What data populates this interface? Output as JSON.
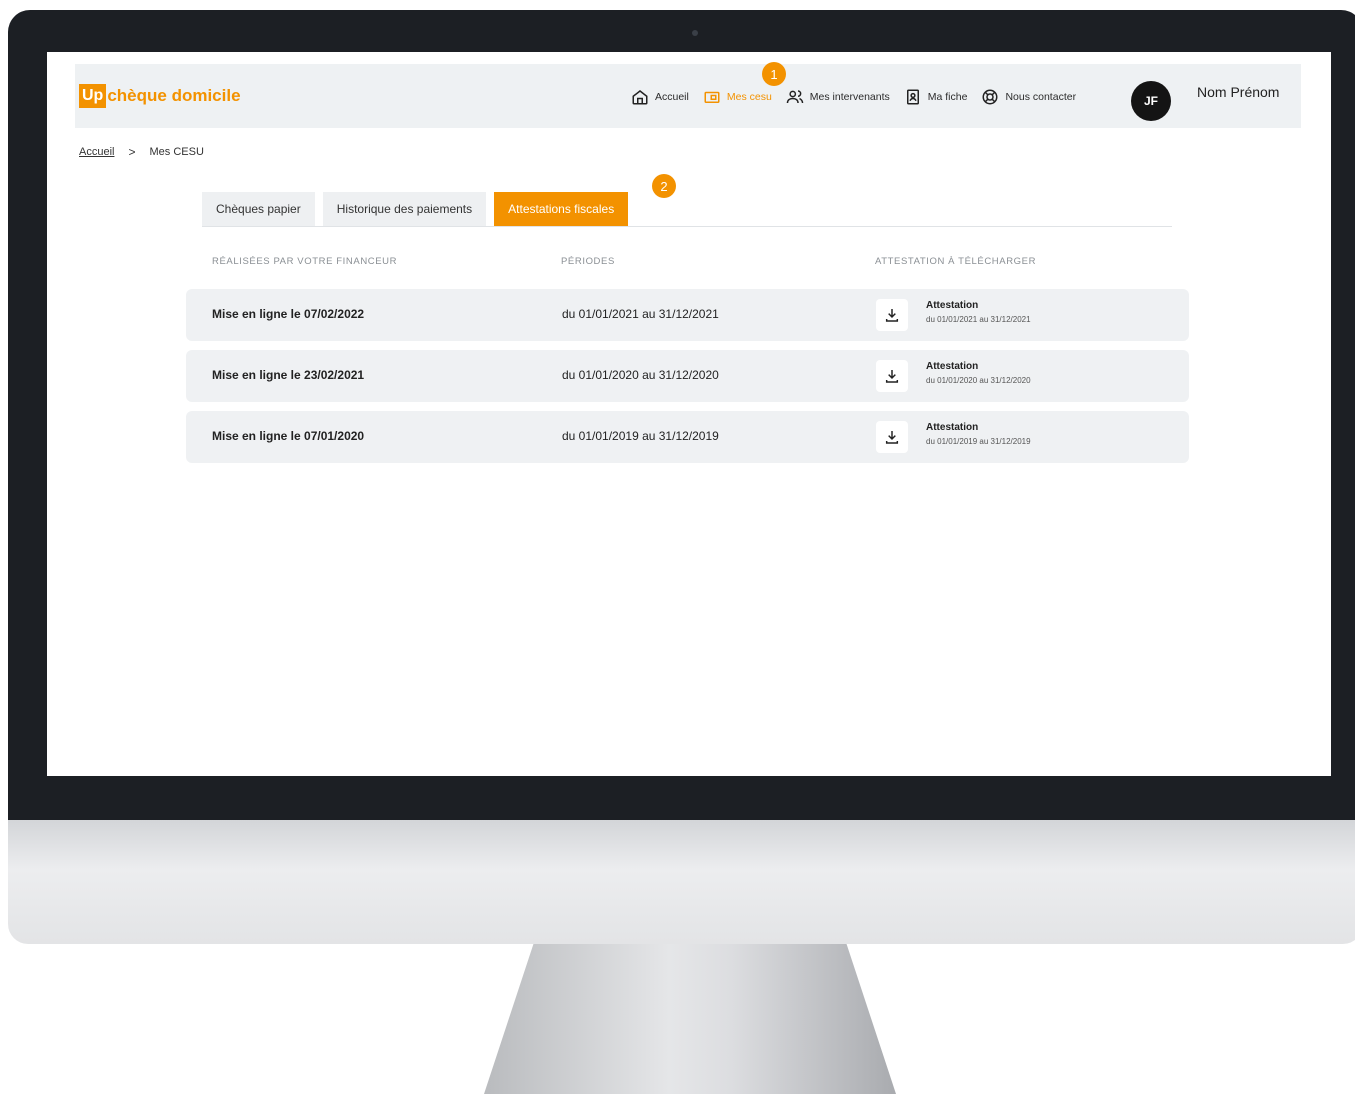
{
  "header": {
    "logo_up": "Up",
    "logo_text": "chèque domicile",
    "nav": [
      {
        "label": "Accueil",
        "icon": "home-icon",
        "active": false
      },
      {
        "label": "Mes cesu",
        "icon": "wallet-icon",
        "active": true
      },
      {
        "label": "Mes intervenants",
        "icon": "users-icon",
        "active": false
      },
      {
        "label": "Ma fiche",
        "icon": "id-card-icon",
        "active": false
      },
      {
        "label": "Nous contacter",
        "icon": "lifebuoy-icon",
        "active": false
      }
    ],
    "avatar_initials": "JF",
    "user_name": "Nom Prénom"
  },
  "markers": {
    "nav": "1",
    "tabs": "2"
  },
  "breadcrumb": {
    "home": "Accueil",
    "separator": ">",
    "current": "Mes CESU"
  },
  "tabs": [
    {
      "label": "Chèques papier",
      "active": false
    },
    {
      "label": "Historique des paiements",
      "active": false
    },
    {
      "label": "Attestations fiscales",
      "active": true
    }
  ],
  "table": {
    "columns": [
      "RÉALISÉES PAR VOTRE FINANCEUR",
      "PÉRIODES",
      "ATTESTATION À TÉLÉCHARGER"
    ],
    "rows": [
      {
        "title": "Mise en ligne le 07/02/2022",
        "period": "du 01/01/2021 au 31/12/2021",
        "att_title": "Attestation",
        "att_sub": "du 01/01/2021 au 31/12/2021"
      },
      {
        "title": "Mise en ligne le 23/02/2021",
        "period": "du 01/01/2020 au 31/12/2020",
        "att_title": "Attestation",
        "att_sub": "du 01/01/2020 au 31/12/2020"
      },
      {
        "title": "Mise en ligne le 07/01/2020",
        "period": "du 01/01/2019 au 31/12/2019",
        "att_title": "Attestation",
        "att_sub": "du 01/01/2019 au 31/12/2019"
      }
    ]
  },
  "colors": {
    "accent": "#f39200",
    "bezel": "#1c1f24",
    "row_bg": "#eff1f3"
  }
}
